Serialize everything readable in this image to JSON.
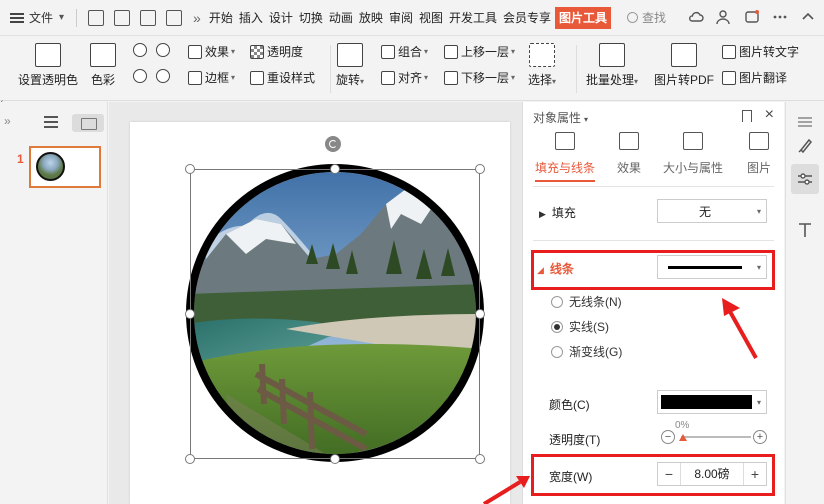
{
  "menubar": {
    "file_label": "文件",
    "tabs": [
      "开始",
      "插入",
      "设计",
      "切换",
      "动画",
      "放映",
      "审阅",
      "视图",
      "开发工具",
      "会员专享",
      "图片工具"
    ],
    "active_tab": "图片工具",
    "search_label": "查找",
    "more_glyph": "»"
  },
  "ribbon": {
    "set_transparent": "设置透明色",
    "color": "色彩",
    "effects": "效果",
    "transparency": "透明度",
    "border": "边框",
    "reset_style": "重设样式",
    "rotate": "旋转",
    "group": "组合",
    "align": "对齐",
    "bring_forward": "上移一层",
    "send_backward": "下移一层",
    "select": "选择",
    "batch": "批量处理",
    "to_pdf": "图片转PDF",
    "to_text": "图片转文字",
    "translate": "图片翻译"
  },
  "thumbs": {
    "slide_number": "1"
  },
  "panel": {
    "title": "对象属性",
    "tabs": [
      "填充与线条",
      "效果",
      "大小与属性",
      "图片"
    ],
    "fill_label": "填充",
    "fill_value": "无",
    "line_label": "线条",
    "radio_none": "无线条(N)",
    "radio_solid": "实线(S)",
    "radio_gradient": "渐变线(G)",
    "color_label": "颜色(C)",
    "transparency_label": "透明度(T)",
    "transparency_value": "0%",
    "width_label": "宽度(W)",
    "width_value": "8.00磅",
    "minus": "−",
    "plus": "+"
  },
  "colors": {
    "accent": "#e8593a",
    "highlight": "#e81e1e"
  }
}
